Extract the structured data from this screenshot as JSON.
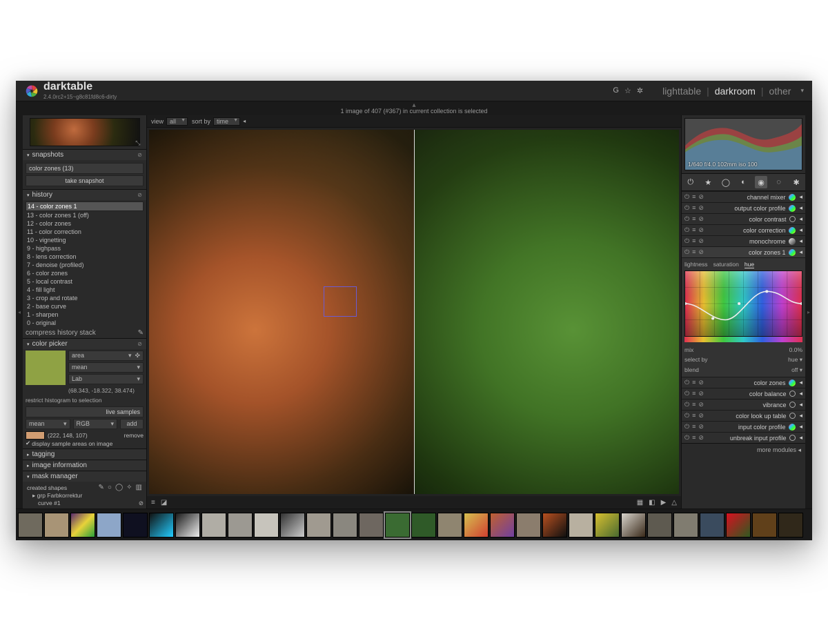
{
  "brand": {
    "name": "darktable",
    "version": "2.4.0rc2+15~g8c81fd8c6-dirty"
  },
  "views": {
    "light": "lighttable",
    "dark": "darkroom",
    "other": "other"
  },
  "statusline": "1 image of 407 (#367) in current collection is selected",
  "topRight": {
    "g": "G",
    "star": "☆",
    "gear": "✲"
  },
  "centerTop": {
    "viewLabel": "view",
    "viewValue": "all",
    "sortLabel": "sort by",
    "sortValue": "time"
  },
  "left": {
    "snapshots": {
      "title": "snapshots",
      "item": "color zones (13)",
      "btn": "take snapshot"
    },
    "history": {
      "title": "history",
      "items": [
        "14 - color zones 1",
        "13 - color zones 1 (off)",
        "12 - color zones",
        "11 - color correction",
        "10 - vignetting",
        "9 - highpass",
        "8 - lens correction",
        "7 - denoise (profiled)",
        "6 - color zones",
        "5 - local contrast",
        "4 - fill light",
        "3 - crop and rotate",
        "2 - base curve",
        "1 - sharpen",
        "0 - original"
      ],
      "selected": 0,
      "compress": "compress history stack"
    },
    "colorPicker": {
      "title": "color picker",
      "mode": "area",
      "stat": "mean",
      "model": "Lab",
      "coords": "(68.343, -18.322, 38.474)",
      "restrict": "restrict histogram to selection",
      "liveSamples": "live samples",
      "colMean": "mean",
      "colModel": "RGB",
      "colAdd": "add",
      "sample": "(222, 148, 107)",
      "remove": "remove",
      "display": "display sample areas on image"
    },
    "tagging": "tagging",
    "imageInfo": "image information",
    "mask": {
      "title": "mask manager",
      "created": "created shapes",
      "grp": "grp Farbkorrektur",
      "curve": "curve #1"
    }
  },
  "histogram": {
    "meta": "1/640 f/4.0 102mm iso 100"
  },
  "toolIcons": [
    "⏻",
    "★",
    "◯",
    "◐",
    "◉",
    "◌",
    "✱"
  ],
  "modules": [
    {
      "name": "channel mixer",
      "type": "dot"
    },
    {
      "name": "output color profile",
      "type": "dot"
    },
    {
      "name": "color contrast",
      "type": "circle"
    },
    {
      "name": "color correction",
      "type": "dot"
    },
    {
      "name": "monochrome",
      "type": "mono"
    },
    {
      "name": "color zones 1",
      "type": "dot",
      "active": true
    }
  ],
  "colorZones": {
    "tabs": [
      "lightness",
      "saturation",
      "hue"
    ],
    "activeTab": 2,
    "mix": "mix",
    "mixVal": "0.0%",
    "selectBy": "select by",
    "selectVal": "hue",
    "blend": "blend",
    "blendVal": "off"
  },
  "modulesBelow": [
    {
      "name": "color zones",
      "type": "dot"
    },
    {
      "name": "color balance",
      "type": "circle"
    },
    {
      "name": "vibrance",
      "type": "circle"
    },
    {
      "name": "color look up table",
      "type": "circle"
    },
    {
      "name": "input color profile",
      "type": "dot"
    },
    {
      "name": "unbreak input profile",
      "type": "circle"
    }
  ],
  "moreModules": "more modules",
  "filmstripCount": 30,
  "filmstripSelected": 14,
  "thumbColors": [
    "#6f6a5e",
    "#a89476",
    "#5a2a6e,#e8d23a,#2aa03a",
    "#8da6c8",
    "#0f1020",
    "#111,#2cf",
    "#1a1a1a,#eee",
    "#b0ada5",
    "#9c9992",
    "#c7c4bc",
    "#333,#ccc",
    "#a09a90",
    "#8a877f",
    "#6e6760",
    "#3a6b32",
    "#2f5a28",
    "#8f8570",
    "#d6c050,#d04030",
    "#c06030,#7040a0",
    "#8b7d6d",
    "#b85020,#101010",
    "#b8b0a0",
    "#d8c030,#4a6a30",
    "#d8d4cc,#3a2a1a",
    "#5e5a50",
    "#807c70",
    "#3a4b5e",
    "#d81020,#305a20",
    "#60401a",
    "#30281a"
  ]
}
